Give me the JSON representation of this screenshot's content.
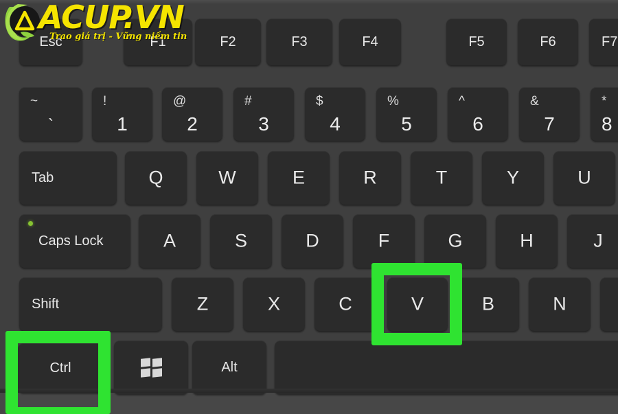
{
  "watermark": {
    "brand": "ACUP.VN",
    "tagline": "Trao giá trị - Vững niềm tin",
    "brand_color": "#f5e400",
    "mark_color": "#8fd13f"
  },
  "theme": {
    "deck_color": "#3f3f3f",
    "key_color": "#2b2b2b",
    "key_text_color": "#e9e9e9",
    "page_background": "#474747",
    "highlight_color": "#2fe331",
    "caps_led_color": "#86c232"
  },
  "keyboard": {
    "description": "Laptop keyboard close-up showing Ctrl and V keys highlighted",
    "function_row": [
      {
        "label": "Esc"
      },
      {
        "label": "F1"
      },
      {
        "label": "F2"
      },
      {
        "label": "F3"
      },
      {
        "label": "F4"
      },
      {
        "label": "F5"
      },
      {
        "label": "F6"
      },
      {
        "label": "F7"
      }
    ],
    "number_row": [
      {
        "shift": "~",
        "digit": "`"
      },
      {
        "shift": "!",
        "digit": "1"
      },
      {
        "shift": "@",
        "digit": "2"
      },
      {
        "shift": "#",
        "digit": "3"
      },
      {
        "shift": "$",
        "digit": "4"
      },
      {
        "shift": "%",
        "digit": "5"
      },
      {
        "shift": "^",
        "digit": "6"
      },
      {
        "shift": "&",
        "digit": "7"
      },
      {
        "shift": "*",
        "digit": "8"
      }
    ],
    "qwerty_row": [
      {
        "label": "Tab"
      },
      {
        "label": "Q"
      },
      {
        "label": "W"
      },
      {
        "label": "E"
      },
      {
        "label": "R"
      },
      {
        "label": "T"
      },
      {
        "label": "Y"
      },
      {
        "label": "U"
      }
    ],
    "home_row": [
      {
        "label": "Caps Lock"
      },
      {
        "label": "A"
      },
      {
        "label": "S"
      },
      {
        "label": "D"
      },
      {
        "label": "F"
      },
      {
        "label": "G"
      },
      {
        "label": "H"
      },
      {
        "label": "J"
      }
    ],
    "shift_row": [
      {
        "label": "Shift"
      },
      {
        "label": "Z"
      },
      {
        "label": "X"
      },
      {
        "label": "C"
      },
      {
        "label": "V"
      },
      {
        "label": "B"
      },
      {
        "label": "N"
      },
      {
        "label": ""
      }
    ],
    "bottom_row": [
      {
        "label": "Ctrl"
      },
      {
        "label": ""
      },
      {
        "label": "Alt"
      },
      {
        "label": ""
      }
    ],
    "highlighted_keys": [
      "Ctrl",
      "V"
    ]
  }
}
